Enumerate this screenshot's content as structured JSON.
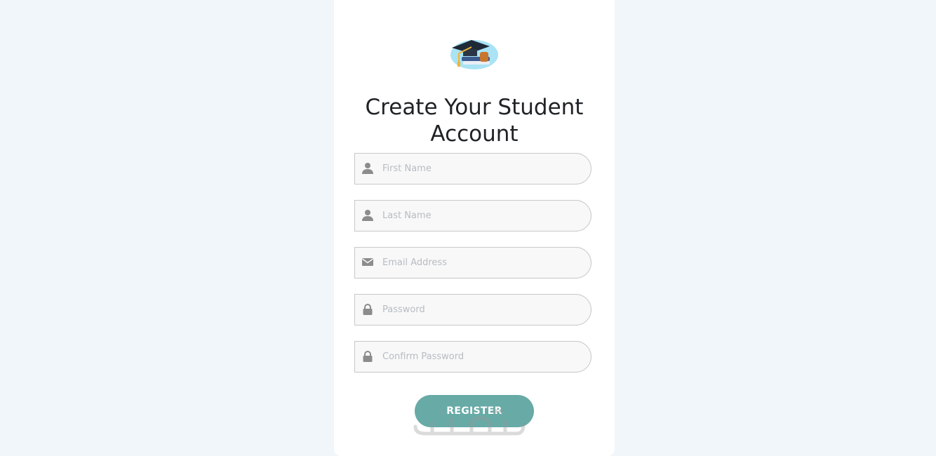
{
  "form": {
    "title": "Create Your Student Account",
    "fields": [
      {
        "placeholder": "First Name",
        "icon": "user-icon",
        "value": ""
      },
      {
        "placeholder": "Last Name",
        "icon": "user-icon",
        "value": ""
      },
      {
        "placeholder": "Email Address",
        "icon": "envelope-icon",
        "value": ""
      },
      {
        "placeholder": "Password",
        "icon": "lock-icon",
        "value": ""
      },
      {
        "placeholder": "Confirm Password",
        "icon": "lock-icon",
        "value": ""
      }
    ],
    "submit_label": "REGISTER"
  },
  "colors": {
    "page_background": "#f1f6fa",
    "card_background": "#ffffff",
    "button": "#67aaa6",
    "icon": "#8c8c8c",
    "field_border": "#c8c8c8"
  },
  "watermark_icon": "watermark-logo"
}
